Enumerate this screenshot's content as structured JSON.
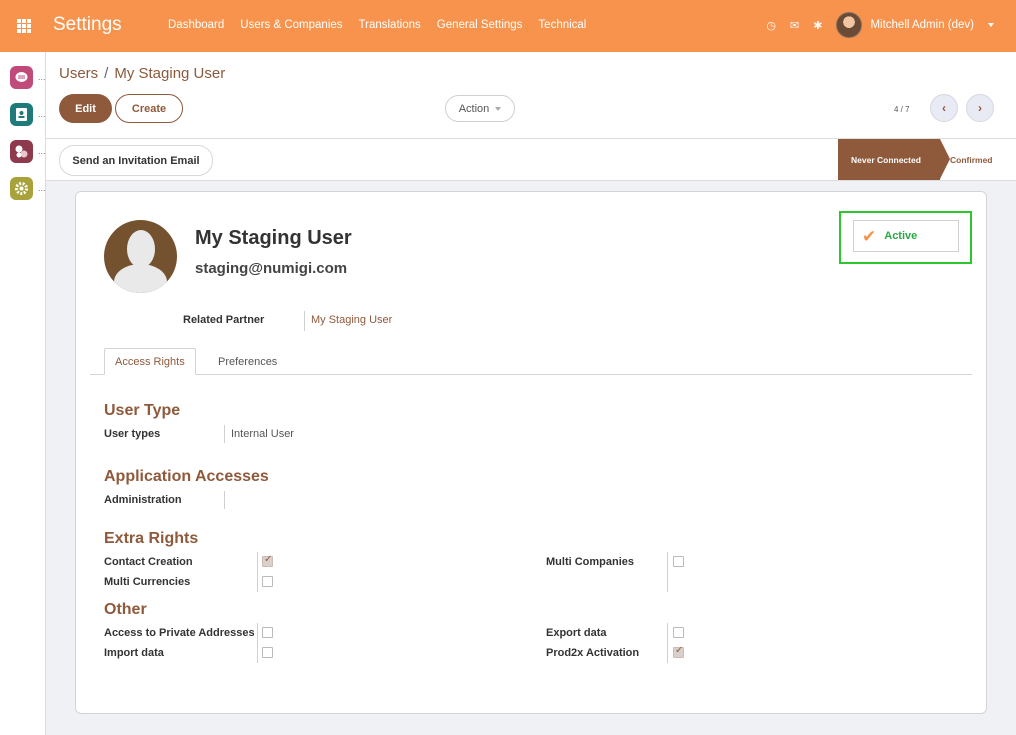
{
  "navbar": {
    "app_title": "Settings",
    "menu": [
      "Dashboard",
      "Users & Companies",
      "Translations",
      "General Settings",
      "Technical"
    ],
    "user_name": "Mitchell Admin (dev)",
    "accent_color": "#f7934d"
  },
  "sidebar": {
    "items": [
      {
        "icon": "chat-icon",
        "color": "#c04a7a",
        "dots": "..."
      },
      {
        "icon": "contacts-icon",
        "color": "#1f7a7a",
        "dots": "..."
      },
      {
        "icon": "apps-icon",
        "color": "#8f3a4c",
        "dots": "..."
      },
      {
        "icon": "gear-icon",
        "color": "#a8a23a",
        "dots": "..."
      }
    ]
  },
  "control": {
    "breadcrumb_parent": "Users",
    "breadcrumb_sep": "/",
    "breadcrumb_current": "My Staging User",
    "edit_label": "Edit",
    "create_label": "Create",
    "action_label": "Action",
    "pager": "4 / 7"
  },
  "status": {
    "invite_label": "Send an Invitation Email",
    "stage_current": "Never Connected",
    "stage_next": "Confirmed"
  },
  "record": {
    "name": "My Staging User",
    "email": "staging@numigi.com",
    "active_label": "Active",
    "related_partner_label": "Related Partner",
    "related_partner_value": "My Staging User"
  },
  "tabs": [
    "Access Rights",
    "Preferences"
  ],
  "access": {
    "user_type_title": "User Type",
    "user_types_label": "User types",
    "user_types_value": "Internal User",
    "app_access_title": "Application Accesses",
    "administration_label": "Administration",
    "extra_rights_title": "Extra Rights",
    "contact_creation": "Contact Creation",
    "multi_currencies": "Multi Currencies",
    "multi_companies": "Multi Companies",
    "other_title": "Other",
    "private_addresses": "Access to Private Addresses",
    "import_data": "Import data",
    "export_data": "Export data",
    "prod2x_activation": "Prod2x Activation"
  },
  "checkboxes": {
    "contact_creation": true,
    "multi_currencies": false,
    "multi_companies": false,
    "private_addresses": false,
    "import_data": false,
    "export_data": false,
    "prod2x_activation": true
  }
}
